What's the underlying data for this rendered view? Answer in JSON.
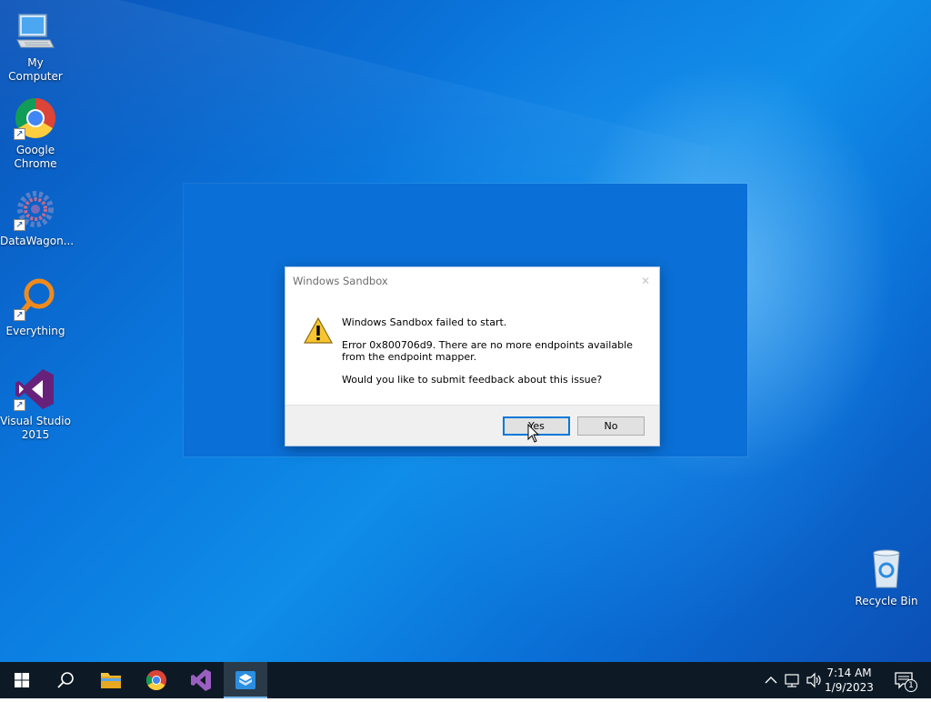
{
  "desktop": {
    "icons": [
      {
        "label": "My Computer"
      },
      {
        "label": "Google Chrome"
      },
      {
        "label": "DataWagon..."
      },
      {
        "label": "Everything"
      },
      {
        "label": "Visual Studio 2015"
      },
      {
        "label": "Recycle Bin"
      }
    ]
  },
  "dialog": {
    "title": "Windows Sandbox",
    "message_heading": "Windows Sandbox failed to start.",
    "message_error": "Error 0x800706d9. There are no more endpoints available from the endpoint mapper.",
    "message_question": "Would you like to submit feedback about this issue?",
    "yes_label": "Yes",
    "no_label": "No"
  },
  "taskbar": {
    "clock_time": "7:14 AM",
    "clock_date": "1/9/2023",
    "notification_count": "1"
  },
  "colors": {
    "accent": "#0078d7",
    "taskbar_bg": "#0d1a26",
    "desktop_blue": "#0a78de"
  }
}
